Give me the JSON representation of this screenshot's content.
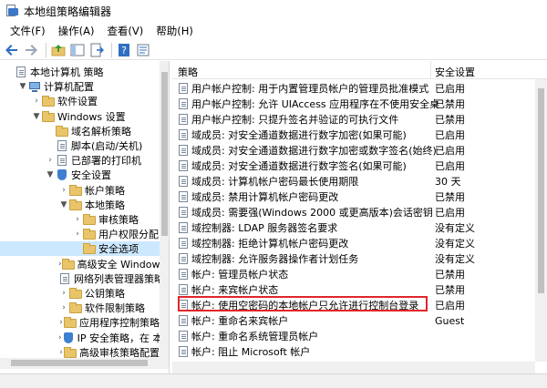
{
  "window": {
    "title": "本地组策略编辑器"
  },
  "menu": [
    "文件(F)",
    "操作(A)",
    "查看(V)",
    "帮助(H)"
  ],
  "toolbar_icons": [
    "back-arrow-icon",
    "forward-arrow-icon",
    "up-folder-icon",
    "show-hide-tree-icon",
    "export-list-icon",
    "help-icon",
    "properties-icon"
  ],
  "tree": [
    {
      "label": "本地计算机 策略",
      "level": 0,
      "arrow": "",
      "icon": "policy"
    },
    {
      "label": "计算机配置",
      "level": 1,
      "arrow": "▼",
      "icon": "computer"
    },
    {
      "label": "软件设置",
      "level": 2,
      "arrow": "›",
      "icon": "folder"
    },
    {
      "label": "Windows 设置",
      "level": 2,
      "arrow": "▼",
      "icon": "folder"
    },
    {
      "label": "域名解析策略",
      "level": 3,
      "arrow": "",
      "icon": "folder"
    },
    {
      "label": "脚本(启动/关机)",
      "level": 3,
      "arrow": "",
      "icon": "policy"
    },
    {
      "label": "已部署的打印机",
      "level": 3,
      "arrow": "›",
      "icon": "policy"
    },
    {
      "label": "安全设置",
      "level": 3,
      "arrow": "▼",
      "icon": "shield"
    },
    {
      "label": "帐户策略",
      "level": 4,
      "arrow": "›",
      "icon": "folder"
    },
    {
      "label": "本地策略",
      "level": 4,
      "arrow": "▼",
      "icon": "folder"
    },
    {
      "label": "审核策略",
      "level": 5,
      "arrow": "›",
      "icon": "folder"
    },
    {
      "label": "用户权限分配",
      "level": 5,
      "arrow": "›",
      "icon": "folder"
    },
    {
      "label": "安全选项",
      "level": 5,
      "arrow": "",
      "icon": "folder",
      "selected": true
    },
    {
      "label": "高级安全 Windows D",
      "level": 4,
      "arrow": "›",
      "icon": "folder"
    },
    {
      "label": "网络列表管理器策略",
      "level": 4,
      "arrow": "",
      "icon": "policy"
    },
    {
      "label": "公钥策略",
      "level": 4,
      "arrow": "›",
      "icon": "folder"
    },
    {
      "label": "软件限制策略",
      "level": 4,
      "arrow": "›",
      "icon": "folder"
    },
    {
      "label": "应用程序控制策略",
      "level": 4,
      "arrow": "›",
      "icon": "folder"
    },
    {
      "label": "IP 安全策略，在 本地",
      "level": 4,
      "arrow": "›",
      "icon": "shield"
    },
    {
      "label": "高级审核策略配置",
      "level": 4,
      "arrow": "›",
      "icon": "folder"
    }
  ],
  "list": {
    "headers": {
      "policy": "策略",
      "setting": "安全设置"
    },
    "rows": [
      {
        "policy": "用户帐户控制: 用于内置管理员帐户的管理员批准模式",
        "setting": "已启用"
      },
      {
        "policy": "用户帐户控制: 允许 UIAccess 应用程序在不使用安全桌面...",
        "setting": "已禁用"
      },
      {
        "policy": "用户帐户控制: 只提升签名并验证的可执行文件",
        "setting": "已禁用"
      },
      {
        "policy": "域成员: 对安全通道数据进行数字加密(如果可能)",
        "setting": "已启用"
      },
      {
        "policy": "域成员: 对安全通道数据进行数字加密或数字签名(始终)",
        "setting": "已启用"
      },
      {
        "policy": "域成员: 对安全通道数据进行数字签名(如果可能)",
        "setting": "已启用"
      },
      {
        "policy": "域成员: 计算机帐户密码最长使用期限",
        "setting": "30 天"
      },
      {
        "policy": "域成员: 禁用计算机帐户密码更改",
        "setting": "已禁用"
      },
      {
        "policy": "域成员: 需要强(Windows 2000 或更高版本)会话密钥",
        "setting": "已启用"
      },
      {
        "policy": "域控制器: LDAP 服务器签名要求",
        "setting": "没有定义"
      },
      {
        "policy": "域控制器: 拒绝计算机帐户密码更改",
        "setting": "没有定义"
      },
      {
        "policy": "域控制器: 允许服务器操作者计划任务",
        "setting": "没有定义"
      },
      {
        "policy": "帐户: 管理员帐户状态",
        "setting": "已禁用"
      },
      {
        "policy": "帐户: 来宾帐户状态",
        "setting": "已禁用"
      },
      {
        "policy": "帐户: 使用空密码的本地帐户只允许进行控制台登录",
        "setting": "已启用",
        "highlighted": true
      },
      {
        "policy": "帐户: 重命名来宾帐户",
        "setting": "Guest"
      },
      {
        "policy": "帐户: 重命名系统管理员帐户",
        "setting": ""
      },
      {
        "policy": "帐户: 阻止 Microsoft 帐户",
        "setting": ""
      }
    ]
  }
}
